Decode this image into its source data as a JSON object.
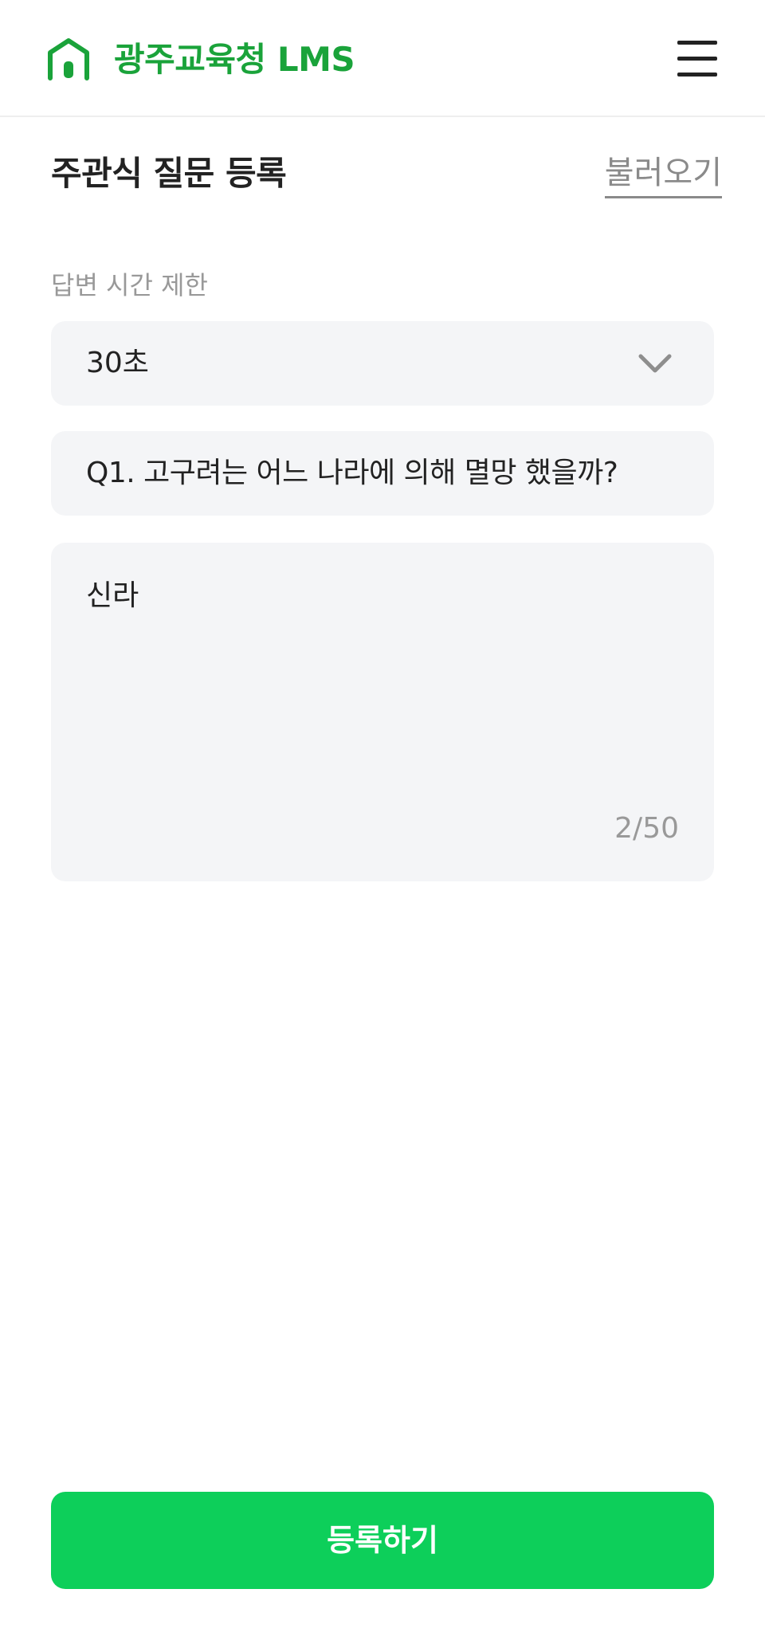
{
  "header": {
    "app_title": "광주교육청 LMS",
    "logo_icon": "home-icon",
    "menu_icon": "hamburger-menu-icon",
    "brand_color": "#1aa33a"
  },
  "page": {
    "title": "주관식 질문 등록",
    "load_link": "불러오기"
  },
  "time_limit": {
    "label": "답변 시간 제한",
    "selected": "30초",
    "dropdown_icon": "chevron-down-icon"
  },
  "question": {
    "value": "Q1. 고구려는 어느 나라에 의해 멸망 했을까?"
  },
  "answer": {
    "value": "신라",
    "char_count": "2/50"
  },
  "submit": {
    "label": "등록하기",
    "color": "#0dcf5a"
  }
}
